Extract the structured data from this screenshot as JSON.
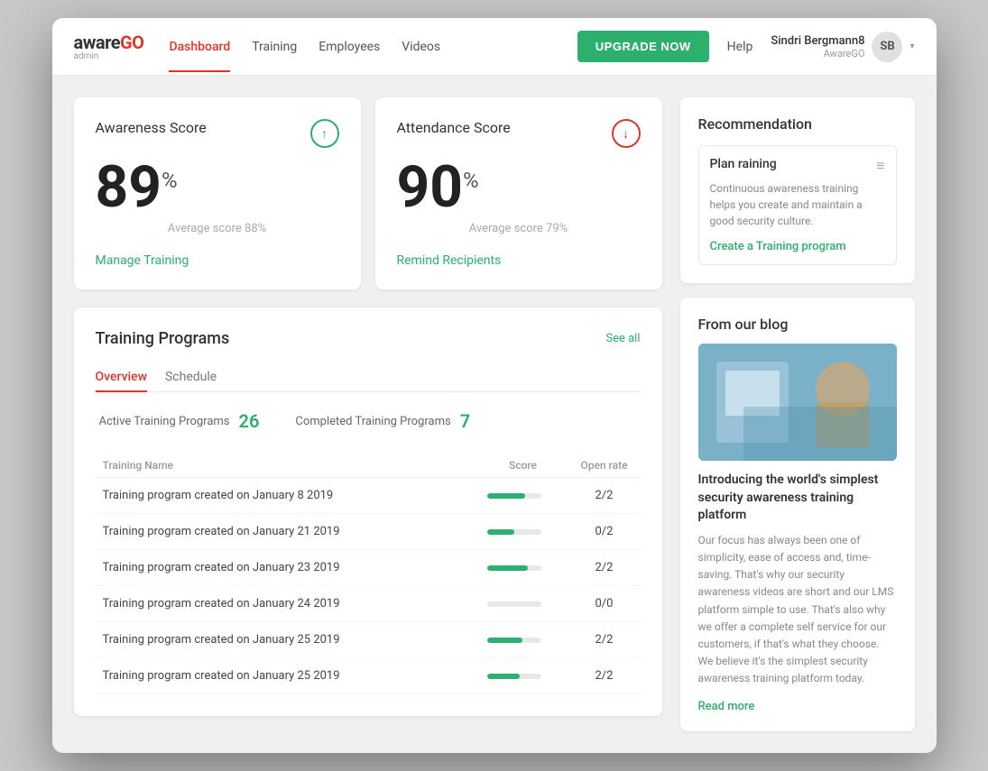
{
  "nav": {
    "logo": "aware",
    "logo_highlight": "GO",
    "logo_sub": "admin",
    "links": [
      {
        "label": "Dashboard",
        "active": true
      },
      {
        "label": "Training",
        "active": false
      },
      {
        "label": "Employees",
        "active": false
      },
      {
        "label": "Videos",
        "active": false
      }
    ],
    "upgrade_btn": "UPGRADE NOW",
    "help": "Help",
    "user_name": "Sindri Bergmann8",
    "user_org": "AwareGO",
    "user_initials": "SB"
  },
  "awareness": {
    "title": "Awareness Score",
    "score": "89",
    "percent": "%",
    "avg_label": "Average score 88%",
    "link": "Manage Training",
    "trend": "up"
  },
  "attendance": {
    "title": "Attendance Score",
    "score": "90",
    "percent": "%",
    "avg_label": "Average score 79%",
    "link": "Remind Recipients",
    "trend": "down"
  },
  "training": {
    "title": "Training Programs",
    "see_all": "See all",
    "tabs": [
      {
        "label": "Overview",
        "active": true
      },
      {
        "label": "Schedule",
        "active": false
      }
    ],
    "active_label": "Active Training Programs",
    "active_count": "26",
    "completed_label": "Completed Training Programs",
    "completed_count": "7",
    "table": {
      "headers": [
        "Training Name",
        "Score",
        "Open rate"
      ],
      "rows": [
        {
          "name": "Training program created on January 8 2019",
          "score_pct": 70,
          "open_rate": "2/2"
        },
        {
          "name": "Training program created on January 21 2019",
          "score_pct": 50,
          "open_rate": "0/2"
        },
        {
          "name": "Training program created on January 23 2019",
          "score_pct": 75,
          "open_rate": "2/2"
        },
        {
          "name": "Training program created on January 24 2019",
          "score_pct": 0,
          "open_rate": "0/0"
        },
        {
          "name": "Training program created on January 25 2019",
          "score_pct": 65,
          "open_rate": "2/2"
        },
        {
          "name": "Training program created on January 25 2019",
          "score_pct": 60,
          "open_rate": "2/2"
        }
      ]
    }
  },
  "recommendation": {
    "title": "Recommendation",
    "item_title": "Plan raining",
    "item_desc": "Continuous awareness training helps you create and maintain a good security culture.",
    "link": "Create a Training program"
  },
  "blog": {
    "title": "From our blog",
    "post_title": "Introducing the world's simplest security awareness training platform",
    "post_desc": "Our focus has always been one of simplicity, ease of access and, time-saving. That's why our security awareness videos are short and our LMS platform simple to use. That's also why we offer a complete self service for our customers, if that's what they choose. We believe it's the simplest security awareness training platform today.",
    "read_more": "Read more"
  }
}
